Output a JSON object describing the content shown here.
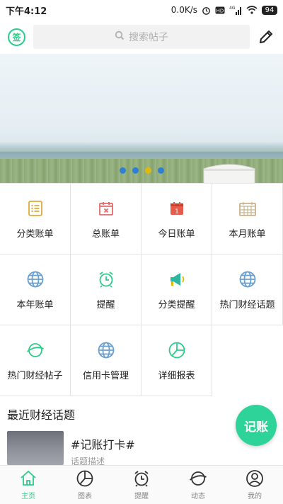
{
  "status_bar": {
    "time": "下午4:12",
    "network_speed": "0.0K/s",
    "signal_label": "4G",
    "battery": "94"
  },
  "topbar": {
    "sign_label": "签",
    "search_placeholder": "搜索帖子"
  },
  "banner": {
    "slide_count": 4,
    "active_slide": 3
  },
  "grid": {
    "items": [
      {
        "label": "分类账单",
        "icon": "list-icon",
        "color": "#e2a93b"
      },
      {
        "label": "总账单",
        "icon": "calendar-x-icon",
        "color": "#e46a6a"
      },
      {
        "label": "今日账单",
        "icon": "calendar-day-icon",
        "color": "#e85a4a"
      },
      {
        "label": "本月账单",
        "icon": "calendar-grid-icon",
        "color": "#c9b38a"
      },
      {
        "label": "本年账单",
        "icon": "globe-icon",
        "color": "#6aa0cf"
      },
      {
        "label": "提醒",
        "icon": "alarm-clock-icon",
        "color": "#2ecc8a"
      },
      {
        "label": "分类提醒",
        "icon": "megaphone-icon",
        "color": "#2ab8a0"
      },
      {
        "label": "热门财经话题",
        "icon": "globe-icon",
        "color": "#6aa0cf"
      },
      {
        "label": "热门财经帖子",
        "icon": "planet-icon",
        "color": "#2ecc8a"
      },
      {
        "label": "信用卡管理",
        "icon": "globe-icon",
        "color": "#6aa0cf"
      },
      {
        "label": "详细报表",
        "icon": "pie-chart-icon",
        "color": "#2ecc8a"
      }
    ]
  },
  "section": {
    "title": "最近财经话题",
    "topics": [
      {
        "title": "#记账打卡#",
        "desc": "话题描述"
      }
    ]
  },
  "fab": {
    "label": "记账"
  },
  "tabbar": {
    "tabs": [
      {
        "label": "主页",
        "icon": "home-icon",
        "active": true
      },
      {
        "label": "图表",
        "icon": "pie-chart-icon",
        "active": false
      },
      {
        "label": "提醒",
        "icon": "alarm-clock-icon",
        "active": false
      },
      {
        "label": "动态",
        "icon": "planet-icon",
        "active": false
      },
      {
        "label": "我的",
        "icon": "user-icon",
        "active": false
      }
    ],
    "active_color": "#2ecc8a",
    "inactive_color": "#888888"
  }
}
